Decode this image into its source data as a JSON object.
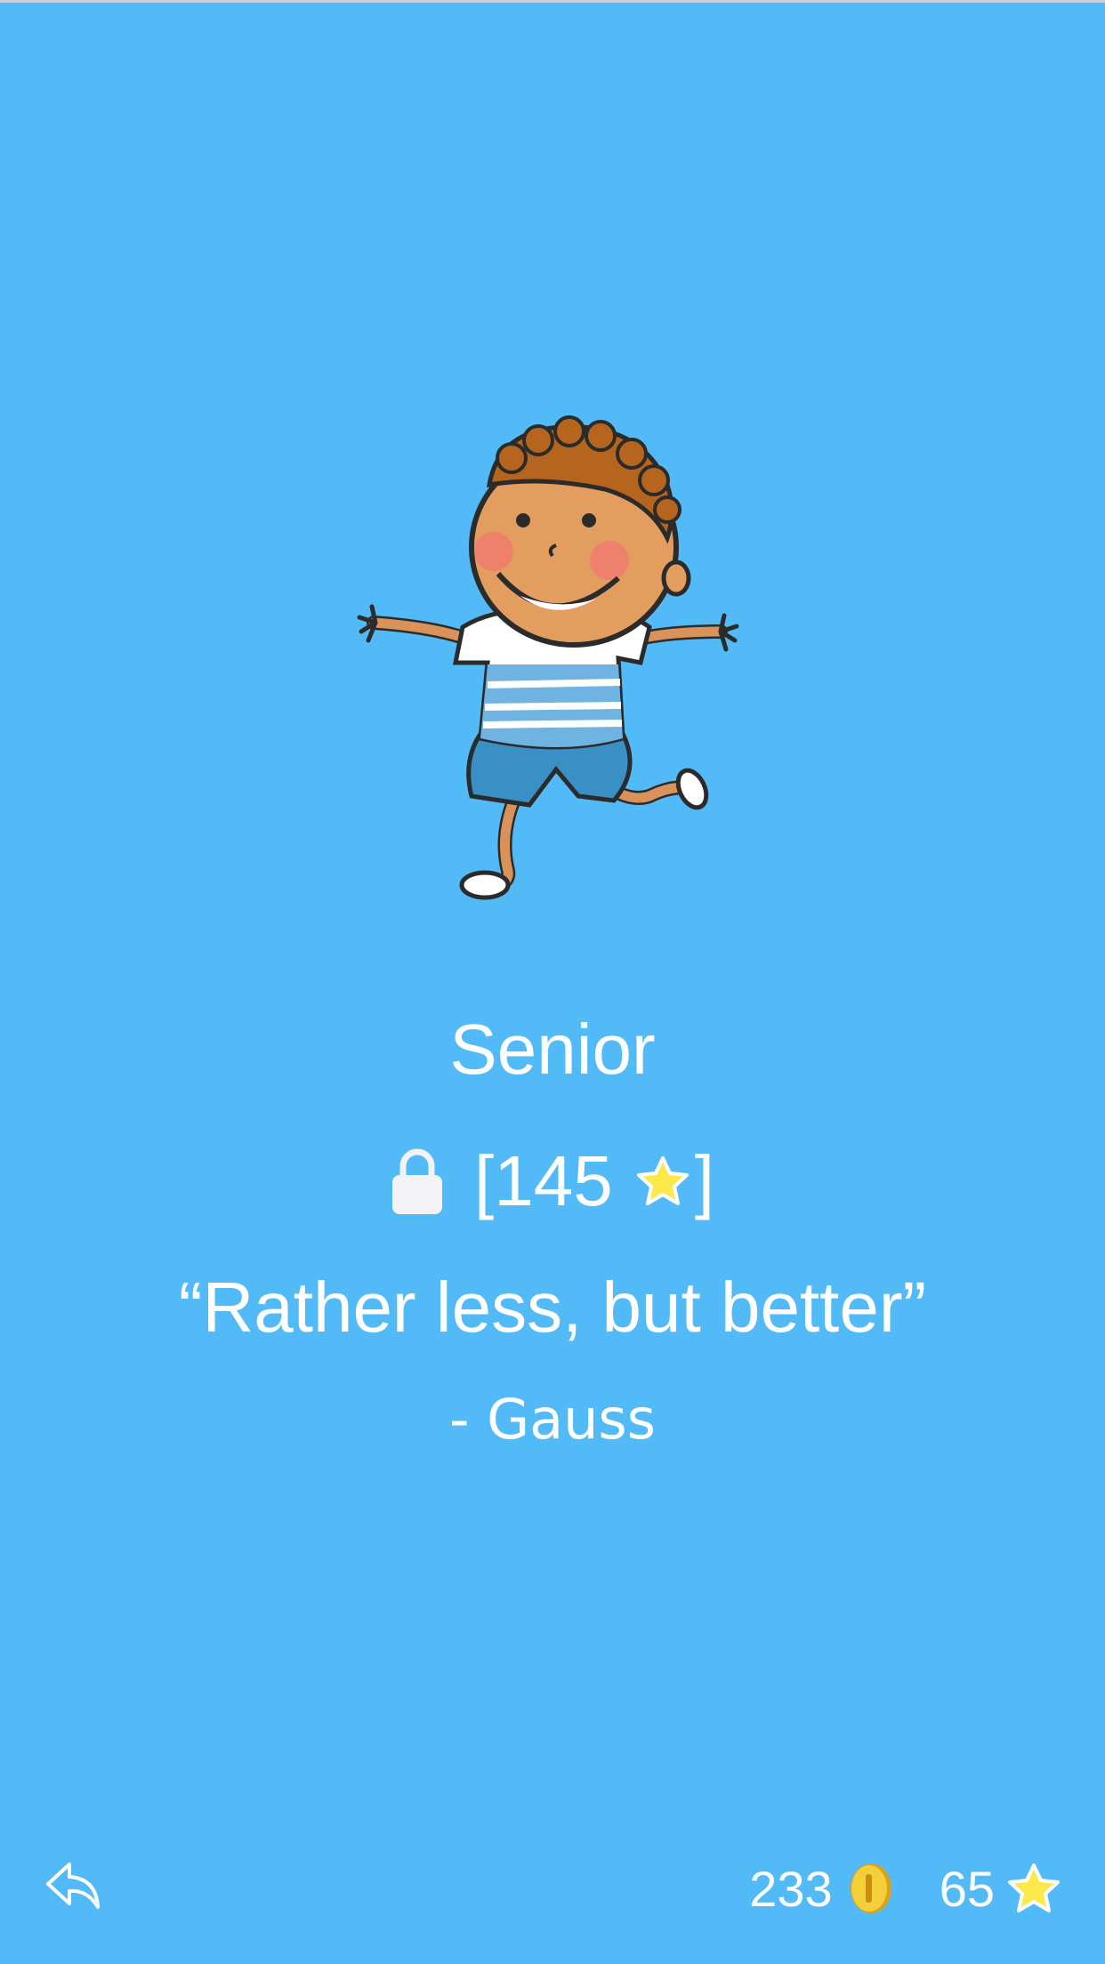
{
  "rank": {
    "title": "Senior",
    "required_stars": "145",
    "bracket_open": "[",
    "bracket_close": "]"
  },
  "quote": {
    "text": "“Rather less, but better”",
    "author": "- Gauss"
  },
  "stats": {
    "coins": "233",
    "stars": "65"
  },
  "icons": {
    "back": "reply-arrow-icon",
    "lock": "lock-icon",
    "coin": "coin-icon",
    "star": "star-icon"
  },
  "colors": {
    "background": "#53baf8",
    "text": "#ffffff",
    "star": "#fbe94a",
    "coin": "#f0c020"
  }
}
